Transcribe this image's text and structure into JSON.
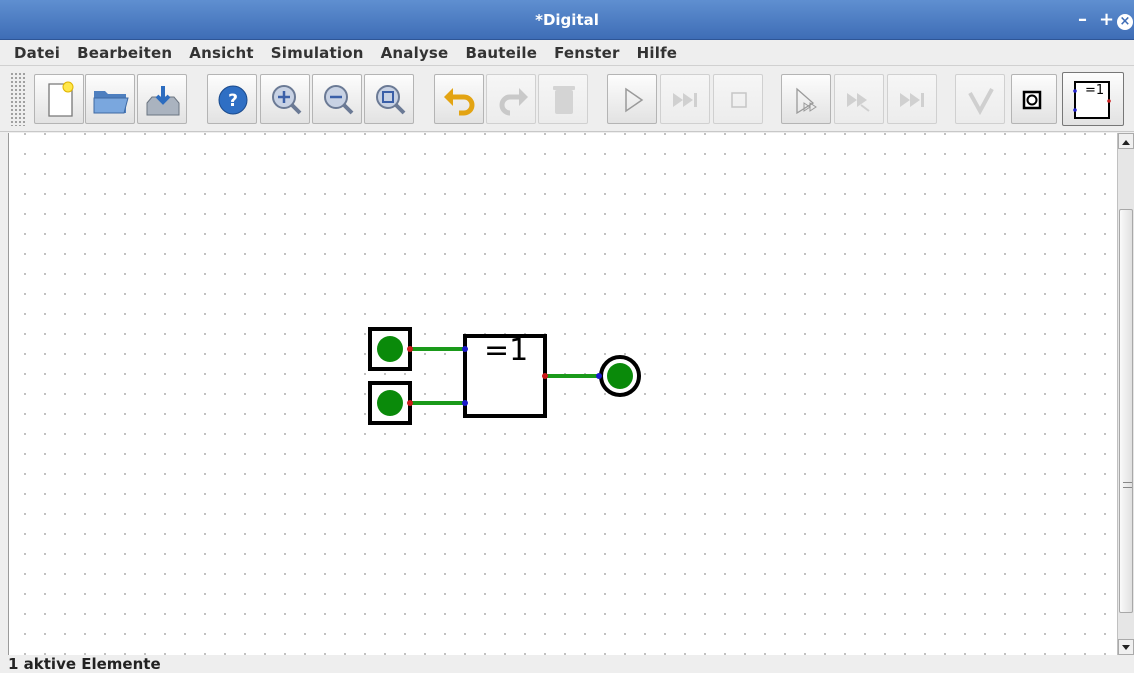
{
  "window": {
    "title": "*Digital",
    "minimize": "–",
    "maximize": "+",
    "close": "×"
  },
  "menu": [
    {
      "label": "Datei"
    },
    {
      "label": "Bearbeiten"
    },
    {
      "label": "Ansicht"
    },
    {
      "label": "Simulation"
    },
    {
      "label": "Analyse"
    },
    {
      "label": "Bauteile"
    },
    {
      "label": "Fenster"
    },
    {
      "label": "Hilfe"
    }
  ],
  "toolbar": {
    "buttons": [
      {
        "icon": "new-document-icon",
        "enabled": true
      },
      {
        "icon": "open-folder-icon",
        "enabled": true
      },
      {
        "icon": "save-icon",
        "enabled": true
      },
      {
        "icon": "help-icon",
        "enabled": true
      },
      {
        "icon": "zoom-in-icon",
        "enabled": true
      },
      {
        "icon": "zoom-out-icon",
        "enabled": true
      },
      {
        "icon": "zoom-fit-icon",
        "enabled": true
      },
      {
        "icon": "undo-icon",
        "enabled": true
      },
      {
        "icon": "redo-icon",
        "enabled": false
      },
      {
        "icon": "delete-icon",
        "enabled": false
      },
      {
        "icon": "play-icon",
        "enabled": true
      },
      {
        "icon": "step-icon",
        "enabled": false
      },
      {
        "icon": "stop-icon",
        "enabled": false
      },
      {
        "icon": "micro-step-icon",
        "enabled": true
      },
      {
        "icon": "run-to-break-icon",
        "enabled": false
      },
      {
        "icon": "run-to-break-micro-icon",
        "enabled": false
      },
      {
        "icon": "analyse-icon",
        "enabled": false
      },
      {
        "icon": "output-component-icon",
        "enabled": true
      },
      {
        "icon": "xor-component-icon",
        "enabled": true,
        "label": "=1"
      }
    ]
  },
  "circuit": {
    "gate_label": "=1",
    "colors": {
      "wire": "#1a9a1a",
      "led_on": "#0a8a0a",
      "input_pin": "#1a1acc",
      "output_pin": "#cc1a1a"
    }
  },
  "status": {
    "text": "1 aktive Elemente"
  }
}
